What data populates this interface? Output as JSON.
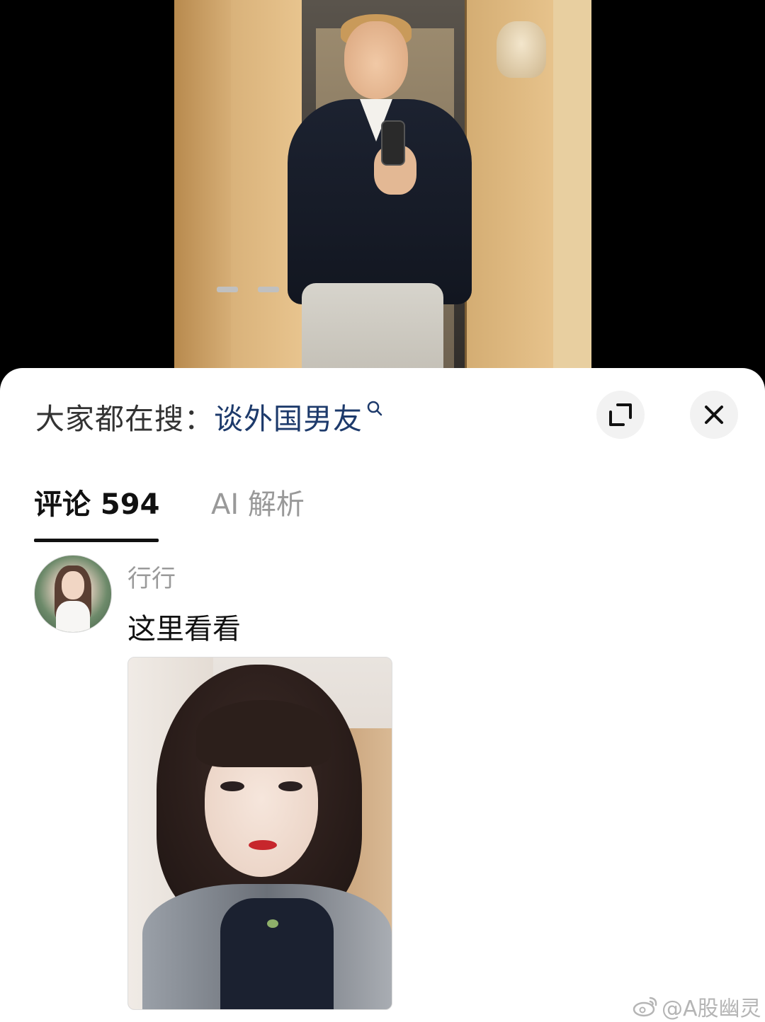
{
  "search": {
    "prefix": "大家都在搜：",
    "term": "谈外国男友"
  },
  "tabs": [
    {
      "label": "评论 594",
      "active": true
    },
    {
      "label": "AI 解析",
      "active": false
    }
  ],
  "comment": {
    "username": "行行",
    "text": "这里看看"
  },
  "watermark": "@A股幽灵",
  "colors": {
    "search_term": "#1d3a6b",
    "active_tab": "#111111",
    "inactive_tab": "#999999"
  }
}
